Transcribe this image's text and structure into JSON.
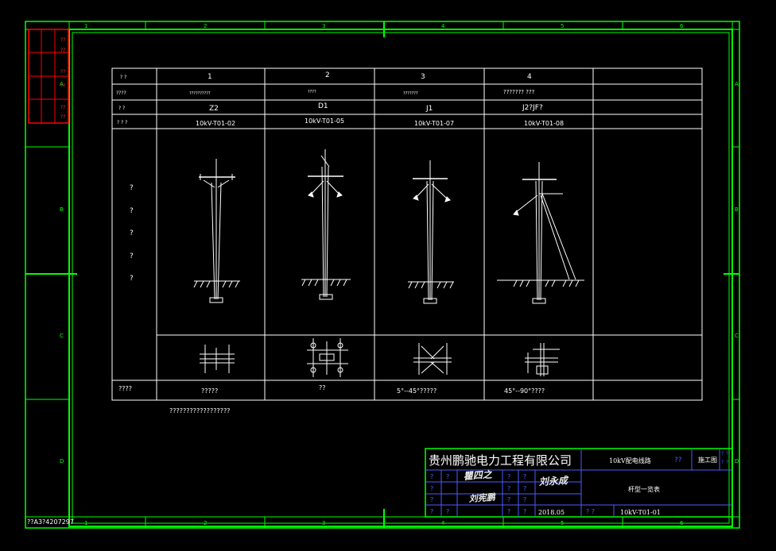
{
  "border": {
    "top_numbers": [
      "1",
      "2",
      "3",
      "4",
      "5",
      "6"
    ],
    "bottom_numbers": [
      "1",
      "2",
      "3",
      "4",
      "5",
      "6"
    ],
    "side_letters": [
      "A",
      "B",
      "C",
      "D"
    ],
    "drawing_code": "??A3?4207297"
  },
  "stamp_box": {
    "cells": [
      "??",
      "??",
      "??",
      "A",
      "??",
      "??",
      "??"
    ]
  },
  "table": {
    "row_labels": [
      "? ?",
      "????",
      "? ?",
      "? ? ?"
    ],
    "columns": [
      {
        "num": "1",
        "name": "??????????",
        "code": "Z2",
        "drawing": "10kV-T01-02",
        "note": "?????"
      },
      {
        "num": "2",
        "name": "????",
        "code": "D1",
        "drawing": "10kV-T01-05",
        "note": "??"
      },
      {
        "num": "3",
        "name": "???????",
        "code": "J1",
        "drawing": "10kV-T01-07",
        "note": "5°--45°?????"
      },
      {
        "num": "4",
        "name": "??????? ???",
        "code": "J2?JF?",
        "drawing": "10kV-T01-08",
        "note": "45°--90°????"
      }
    ],
    "diagram_label": [
      "?",
      "?",
      "?",
      "?",
      "?"
    ],
    "note_label": "????"
  },
  "footnote": "??????????????????",
  "title_block": {
    "company": "贵州鹏驰电力工程有限公司",
    "project": "10kV配电线路",
    "project_mark": "??",
    "stage": "施工图",
    "stage_marks": [
      "?",
      "?",
      "?",
      "?"
    ],
    "drawing_title": "杆型一览表",
    "date": "2018.05",
    "drawing_no": "10kV-T01-01",
    "no_marks": "? ?",
    "signatures": [
      "瞿四之",
      "刘宪鹏",
      "刘永成"
    ],
    "grid_marks": [
      "?",
      "?",
      "?",
      "?",
      "?",
      "?",
      "?",
      "?",
      "?",
      "?",
      "?",
      "?",
      "?",
      "?",
      "?"
    ]
  },
  "colors": {
    "frame": "#00ff00",
    "lines": "#ffffff",
    "title_lines": "#4a5cff",
    "stamp": "#ff0000",
    "background": "#000000"
  }
}
